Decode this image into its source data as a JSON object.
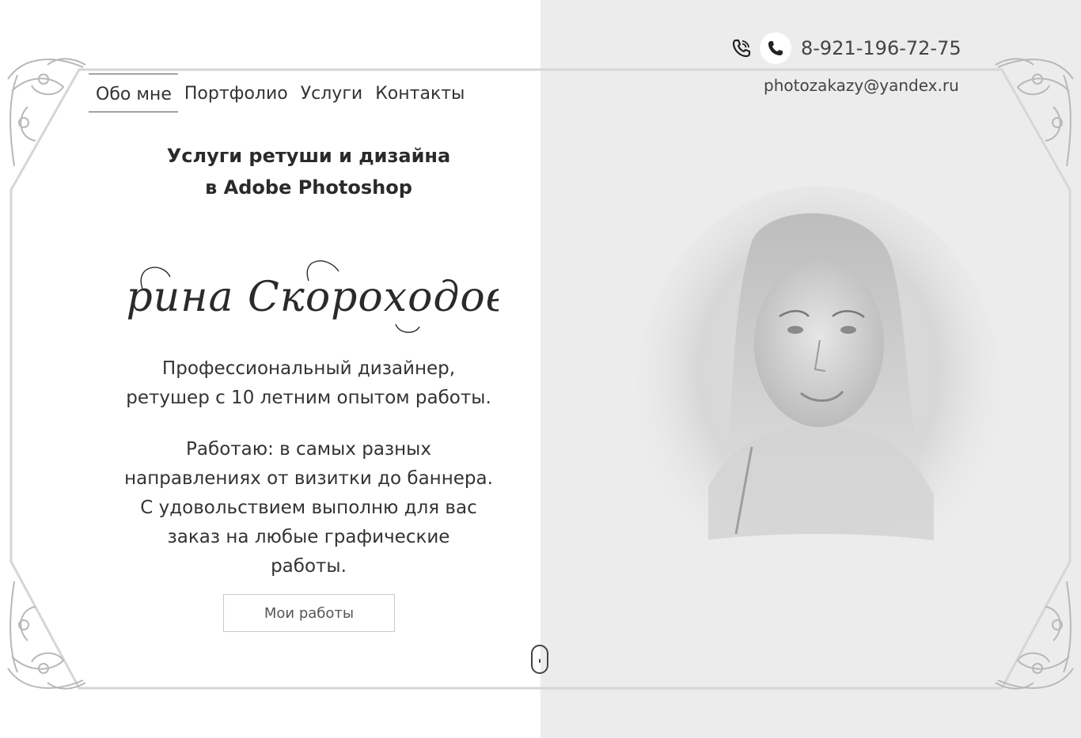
{
  "nav": {
    "items": [
      {
        "label": "Обо мне",
        "active": true
      },
      {
        "label": "Портфолио",
        "active": false
      },
      {
        "label": "Услуги",
        "active": false
      },
      {
        "label": "Контакты",
        "active": false
      }
    ]
  },
  "contacts": {
    "phone": "8-921-196-72-75",
    "email": "photozakazy@yandex.ru",
    "icons": [
      "viber-icon",
      "whatsapp-icon"
    ]
  },
  "hero": {
    "headline_line1": "Услуги ретуши и дизайна",
    "headline_line2": "в Adobe Photoshop",
    "signature": "Ирина Скороходова",
    "intro_line1": "Профессиональный дизайнер,",
    "intro_line2": "ретушер с 10 летним опытом работы.",
    "work_line1": "Работаю: в самых разных",
    "work_line2": "направлениях от визитки до баннера.",
    "work_line3": "С удовольствием выполню для вас",
    "work_line4": "заказ на любые графические",
    "work_line5": "работы.",
    "button_label": "Мои работы"
  },
  "colors": {
    "background_left": "#ffffff",
    "background_right": "#ececec",
    "text": "#333333",
    "frame": "#d9d9d9"
  }
}
